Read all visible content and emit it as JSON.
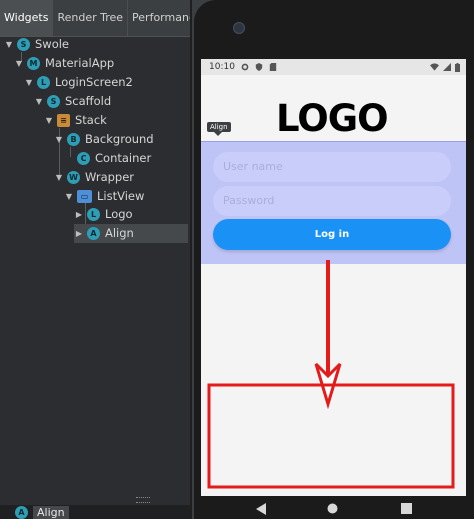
{
  "inspector": {
    "tabs": [
      {
        "label": "Widgets"
      },
      {
        "label": "Render Tree"
      },
      {
        "label": "Performance"
      }
    ],
    "tree": [
      {
        "label": "Swole",
        "badge": "S"
      },
      {
        "label": "MaterialApp",
        "badge": "M"
      },
      {
        "label": "LoginScreen2",
        "badge": "L"
      },
      {
        "label": "Scaffold",
        "badge": "S"
      },
      {
        "label": "Stack",
        "badge": ""
      },
      {
        "label": "Background",
        "badge": "B"
      },
      {
        "label": "Container",
        "badge": "C"
      },
      {
        "label": "Wrapper",
        "badge": "W"
      },
      {
        "label": "ListView",
        "badge": ""
      },
      {
        "label": "Logo",
        "badge": "L"
      },
      {
        "label": "Align",
        "badge": "A"
      }
    ],
    "selected_widget": {
      "label": "Align",
      "badge": "A"
    }
  },
  "phone": {
    "status_time": "10:10",
    "logo": "LOGO",
    "tooltip": "Align",
    "username_placeholder": "User name",
    "password_placeholder": "Password",
    "login_button": "Log in"
  },
  "colors": {
    "accent_blue": "#1a92f5",
    "login_box": "#bfc4f7",
    "annotation_red": "#e31b1b"
  },
  "icons": [
    "gear-icon",
    "shield-icon",
    "sd-card-icon",
    "wifi-icon",
    "signal-icon",
    "battery-icon",
    "back-icon",
    "home-icon",
    "recents-icon"
  ]
}
